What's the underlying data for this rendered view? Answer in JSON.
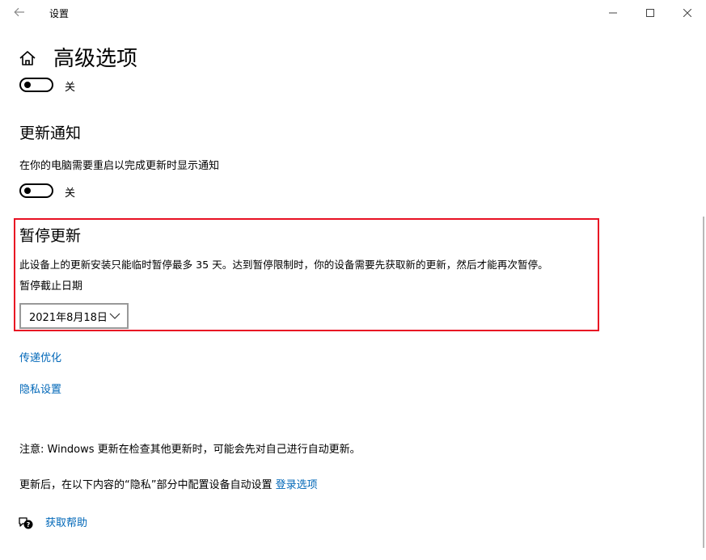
{
  "window": {
    "title": "设置"
  },
  "page": {
    "title": "高级选项"
  },
  "top_toggle": {
    "state_label": "关"
  },
  "update_notifications": {
    "heading": "更新通知",
    "description": "在你的电脑需要重启以完成更新时显示通知",
    "toggle_state": "关"
  },
  "pause_updates": {
    "heading": "暂停更新",
    "description": "此设备上的更新安装只能临时暂停最多 35 天。达到暂停限制时，你的设备需要先获取新的更新，然后才能再次暂停。",
    "date_label": "暂停截止日期",
    "selected_date": "2021年8月18日"
  },
  "links": {
    "delivery_optimization": "传递优化",
    "privacy_settings": "隐私设置"
  },
  "notes": {
    "note": "注意: Windows 更新在检查其他更新时，可能会先对自己进行自动更新。",
    "after_update_prefix": "更新后，在以下内容的“隐私”部分中配置设备自动设置 ",
    "sign_in_options": "登录选项"
  },
  "help": {
    "label": "获取帮助"
  },
  "colors": {
    "link": "#0067b8",
    "highlight_border": "#e81123"
  }
}
